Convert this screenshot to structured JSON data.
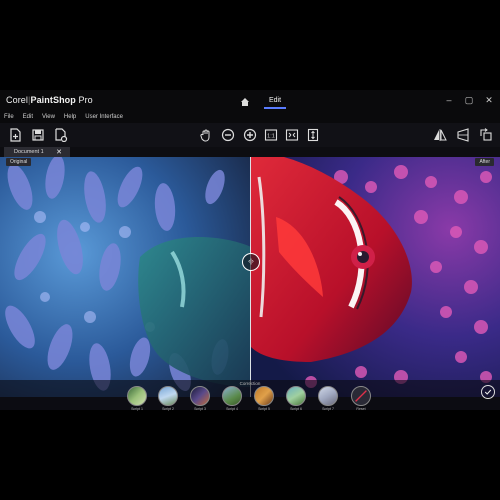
{
  "app": {
    "brand_prefix": "Corel",
    "brand_name": "PaintShop",
    "brand_suffix": "Pro",
    "tab_edit": "Edit"
  },
  "menu": [
    "File",
    "Edit",
    "View",
    "Help",
    "User Interface"
  ],
  "document": {
    "tab_label": "Document 1",
    "close": "✕"
  },
  "compare": {
    "left_label": "Original",
    "right_label": "After",
    "handle": "‹|›"
  },
  "presets": {
    "title": "Correction",
    "items": [
      {
        "label": "Script 1"
      },
      {
        "label": "Script 2"
      },
      {
        "label": "Script 3"
      },
      {
        "label": "Script 4"
      },
      {
        "label": "Script 5"
      },
      {
        "label": "Script 6"
      },
      {
        "label": "Script 7"
      },
      {
        "label": "Reset"
      }
    ]
  },
  "icons": {
    "toolbar_left": [
      "new-file-icon",
      "save-icon",
      "export-icon"
    ],
    "toolbar_center": [
      "pan-hand-icon",
      "zoom-out-icon",
      "zoom-in-icon",
      "actual-size-icon",
      "fit-window-icon",
      "fit-height-icon"
    ],
    "toolbar_right": [
      "flip-icon",
      "perspective-icon",
      "crop-rotate-icon"
    ]
  },
  "colors": {
    "accent": "#5a7cff",
    "bg": "#101014"
  }
}
